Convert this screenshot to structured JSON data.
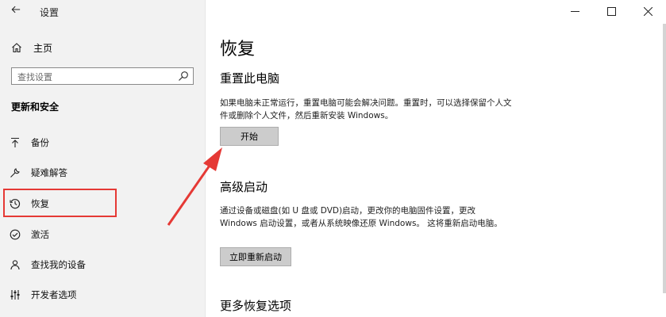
{
  "window": {
    "title": "设置",
    "back_icon": "back-arrow-icon"
  },
  "sidebar": {
    "home_label": "主页",
    "search_placeholder": "查找设置",
    "section_heading": "更新和安全",
    "items": [
      {
        "label": "备份",
        "icon": "backup-arrow-icon"
      },
      {
        "label": "疑难解答",
        "icon": "wrench-icon"
      },
      {
        "label": "恢复",
        "icon": "history-icon",
        "selected": true
      },
      {
        "label": "激活",
        "icon": "check-circle-icon"
      },
      {
        "label": "查找我的设备",
        "icon": "person-locate-icon"
      },
      {
        "label": "开发者选项",
        "icon": "developer-sliders-icon"
      }
    ]
  },
  "main": {
    "page_title": "恢复",
    "reset": {
      "heading": "重置此电脑",
      "description": "如果电脑未正常运行，重置电脑可能会解决问题。重置时，可以选择保留个人文件或删除个人文件，然后重新安装 Windows。",
      "button_label": "开始"
    },
    "advanced": {
      "heading": "高级启动",
      "description": "通过设备或磁盘(如 U 盘或 DVD)启动，更改你的电脑固件设置，更改 Windows 启动设置，或者从系统映像还原 Windows。 这将重新启动电脑。",
      "button_label": "立即重新启动"
    },
    "more": {
      "heading": "更多恢复选项"
    }
  },
  "colors": {
    "sidebar_bg": "#f2f2f2",
    "annotation_red": "#e53935",
    "button_bg": "#cccccc"
  }
}
